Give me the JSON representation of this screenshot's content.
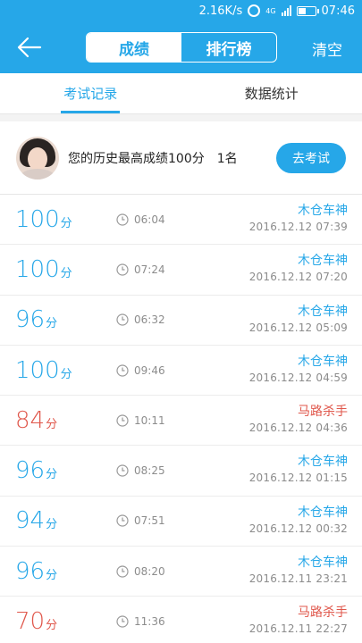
{
  "status_bar": {
    "speed": "2.16K/s",
    "network": "4G",
    "time": "07:46",
    "battery_level": 0.5
  },
  "header": {
    "tabs": [
      "成绩",
      "排行榜"
    ],
    "active_tab": 0,
    "clear_label": "清空"
  },
  "sub_tabs": {
    "items": [
      "考试记录",
      "数据统计"
    ],
    "active": 0
  },
  "profile": {
    "best_text": "您的历史最高成绩100分",
    "rank_text": "1名",
    "button_label": "去考试"
  },
  "colors": {
    "accent": "#26a7e8",
    "red": "#e0574b"
  },
  "records": [
    {
      "score": "100",
      "unit": "分",
      "duration": "06:04",
      "name": "木仓车神",
      "datetime": "2016.12.12  07:39",
      "color": "blue"
    },
    {
      "score": "100",
      "unit": "分",
      "duration": "07:24",
      "name": "木仓车神",
      "datetime": "2016.12.12  07:20",
      "color": "blue"
    },
    {
      "score": "96",
      "unit": "分",
      "duration": "06:32",
      "name": "木仓车神",
      "datetime": "2016.12.12  05:09",
      "color": "blue"
    },
    {
      "score": "100",
      "unit": "分",
      "duration": "09:46",
      "name": "木仓车神",
      "datetime": "2016.12.12  04:59",
      "color": "blue"
    },
    {
      "score": "84",
      "unit": "分",
      "duration": "10:11",
      "name": "马路杀手",
      "datetime": "2016.12.12  04:36",
      "color": "red"
    },
    {
      "score": "96",
      "unit": "分",
      "duration": "08:25",
      "name": "木仓车神",
      "datetime": "2016.12.12  01:15",
      "color": "blue"
    },
    {
      "score": "94",
      "unit": "分",
      "duration": "07:51",
      "name": "木仓车神",
      "datetime": "2016.12.12  00:32",
      "color": "blue"
    },
    {
      "score": "96",
      "unit": "分",
      "duration": "08:20",
      "name": "木仓车神",
      "datetime": "2016.12.11  23:21",
      "color": "blue"
    },
    {
      "score": "70",
      "unit": "分",
      "duration": "11:36",
      "name": "马路杀手",
      "datetime": "2016.12.11  22:27",
      "color": "red"
    }
  ]
}
